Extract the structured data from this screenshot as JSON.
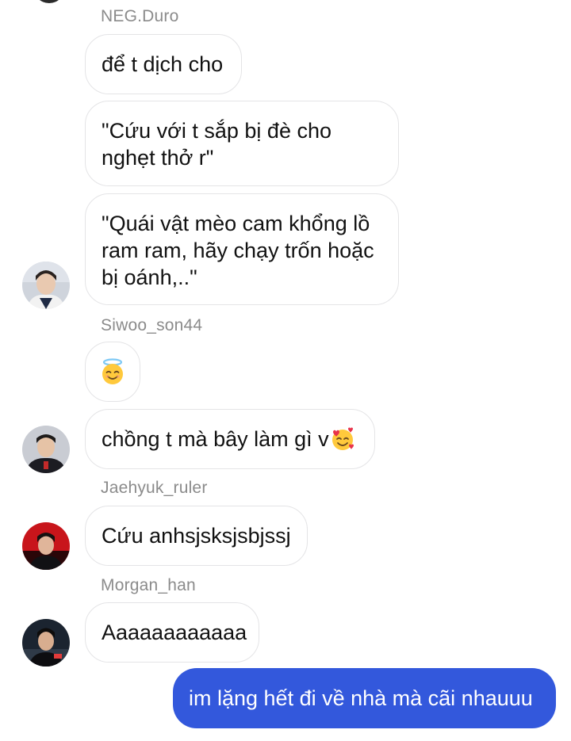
{
  "messages": [
    {
      "sender": "NEG.Duro",
      "text": "để t dịch cho"
    },
    {
      "text": "\"Cứu với t sắp bị đè cho\nnghẹt thở r\""
    },
    {
      "text": "\"Quái vật mèo cam khổng lồ\nram ram, hãy chạy trốn hoặc\nbị oánh,..\""
    },
    {
      "sender": "Siwoo_son44",
      "emoji": "smiling-face-with-halo"
    },
    {
      "text": "chồng t mà bây làm gì v",
      "emoji": "smiling-face-with-hearts"
    },
    {
      "sender": "Jaehyuk_ruler",
      "text": "Cứu anhsjsksjsbjssj"
    },
    {
      "sender": "Morgan_han",
      "text": "Aaaaaaaaaaaa"
    },
    {
      "text": "im lặng hết đi về nhà mà cãi nhauuu",
      "mine": true
    }
  ],
  "colors": {
    "my_bubble": "#3358dc",
    "other_bubble_border": "#e4e4e6",
    "sender_name": "#8b8b8b"
  }
}
